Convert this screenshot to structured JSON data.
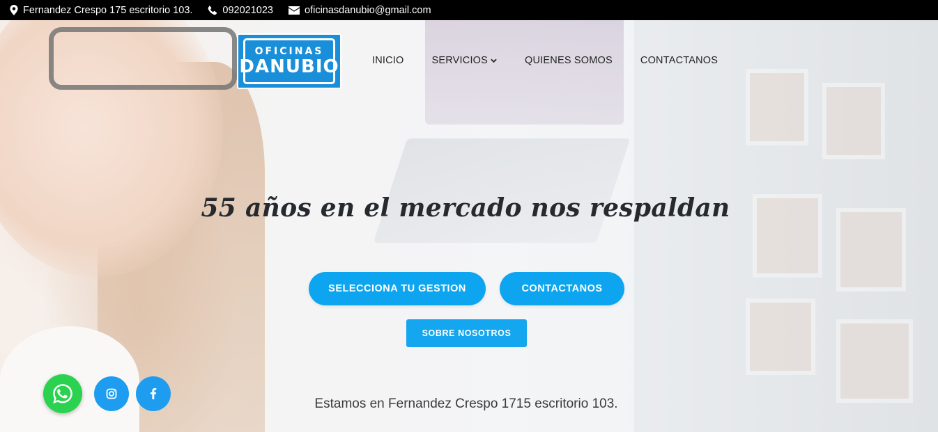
{
  "topbar": {
    "address": "Fernandez Crespo 175 escritorio 103.",
    "phone": "092021023",
    "email": "oficinasdanubio@gmail.com",
    "icons": [
      "map-marker-icon",
      "phone-icon",
      "envelope-icon"
    ]
  },
  "logo": {
    "line1": "OFICINAS",
    "line2": "DANUBIO"
  },
  "nav": {
    "items": [
      {
        "label": "INICIO"
      },
      {
        "label": "SERVICIOS",
        "dropdown": true
      },
      {
        "label": "QUIENES SOMOS"
      },
      {
        "label": "CONTACTANOS"
      }
    ]
  },
  "hero": {
    "headline": "55 años en el mercado nos respaldan",
    "btn_select": "SELECCIONA TU GESTION",
    "btn_contact": "CONTACTANOS",
    "btn_about": "SOBRE NOSOTROS",
    "address_line": "Estamos en Fernandez Crespo 1715 escritorio 103."
  },
  "social": {
    "icons": [
      "whatsapp-icon",
      "instagram-icon",
      "facebook-icon"
    ]
  },
  "colors": {
    "accent": "#0ea5f0",
    "whatsapp": "#2bd24f",
    "topbar": "#000000",
    "logo": "#1a8fd9"
  }
}
